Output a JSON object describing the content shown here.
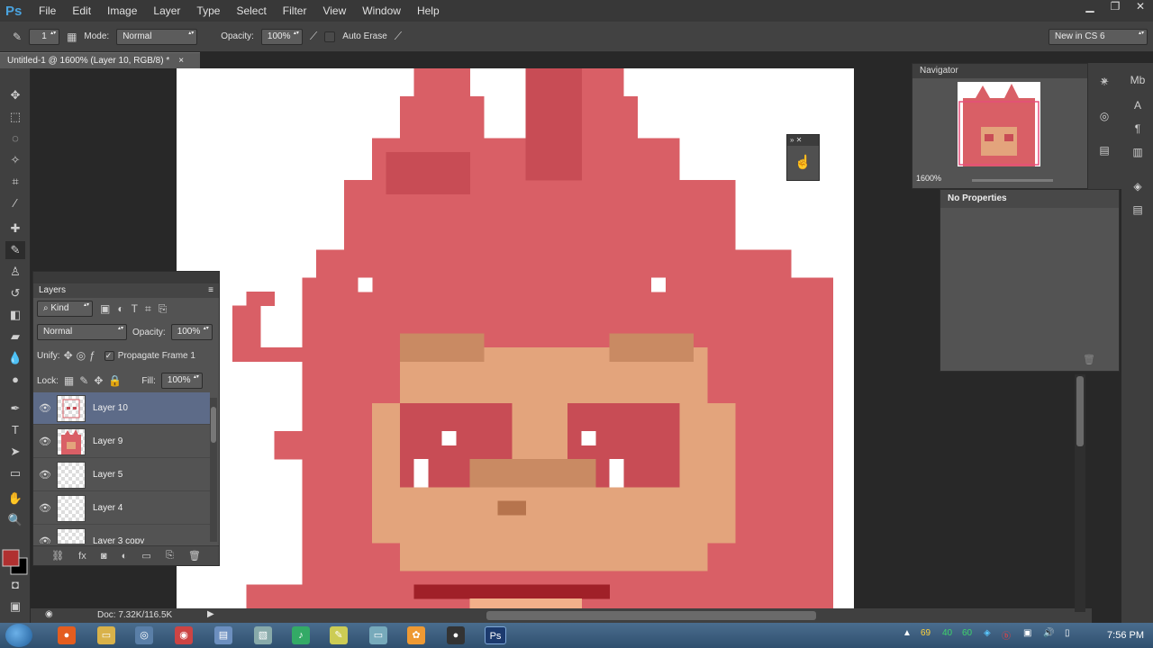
{
  "app": {
    "logo": "Ps"
  },
  "menu": [
    "File",
    "Edit",
    "Image",
    "Layer",
    "Type",
    "Select",
    "Filter",
    "View",
    "Window",
    "Help"
  ],
  "options_bar": {
    "brush_size": "1",
    "mode_label": "Mode:",
    "mode_value": "Normal",
    "opacity_label": "Opacity:",
    "opacity_value": "100%",
    "auto_erase_label": "Auto Erase",
    "workspace": "New in CS 6"
  },
  "document": {
    "tab_title": "Untitled-1 @ 1600% (Layer 10, RGB/8) *",
    "close": "×"
  },
  "status": {
    "doc_info": "Doc: 7.32K/116.5K"
  },
  "navigator": {
    "title": "Navigator",
    "zoom": "1600%"
  },
  "properties": {
    "title": "No Properties"
  },
  "layers_panel": {
    "title": "Layers",
    "kind_filter": "Kind",
    "blend_mode": "Normal",
    "opacity_label": "Opacity:",
    "opacity_value": "100%",
    "unify_label": "Unify:",
    "propagate_label": "Propagate Frame 1",
    "lock_label": "Lock:",
    "fill_label": "Fill:",
    "fill_value": "100%",
    "layers": [
      {
        "name": "Layer 10",
        "selected": true
      },
      {
        "name": "Layer 9",
        "selected": false
      },
      {
        "name": "Layer 5",
        "selected": false
      },
      {
        "name": "Layer 4",
        "selected": false
      },
      {
        "name": "Layer 3 copy",
        "selected": false
      }
    ]
  },
  "colors": {
    "foreground": "#b03030",
    "background": "#000000",
    "hair": "#d95f66",
    "skin": "#e3a47c"
  },
  "taskbar": {
    "clock": "7:56 PM",
    "tray_numbers": [
      "69",
      "40",
      "60"
    ]
  }
}
